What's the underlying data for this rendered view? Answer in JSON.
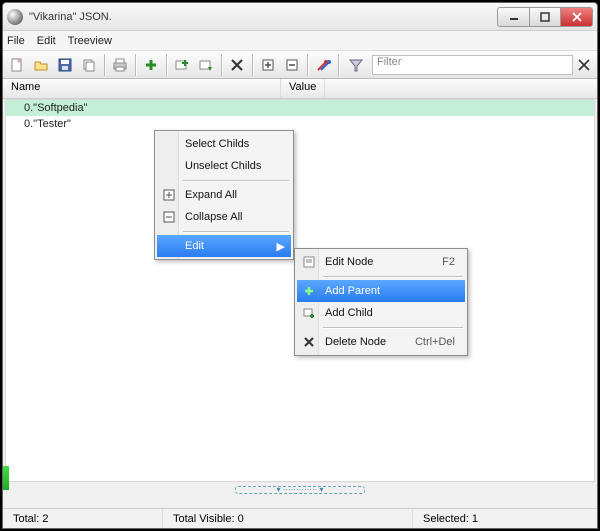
{
  "window": {
    "title": "\"Vikarina\" JSON."
  },
  "menu": {
    "file": "File",
    "edit": "Edit",
    "treeview": "Treeview"
  },
  "toolbar": {
    "filter_label": "Filter",
    "filter_value": ""
  },
  "columns": {
    "name": "Name",
    "value": "Value"
  },
  "tree": {
    "rows": [
      {
        "text": "0.\"Softpedia\"",
        "selected": true
      },
      {
        "text": "0.\"Tester\"",
        "selected": false
      }
    ]
  },
  "context_menu_1": {
    "select_childs": "Select Childs",
    "unselect_childs": "Unselect Childs",
    "expand_all": "Expand All",
    "collapse_all": "Collapse All",
    "edit": "Edit"
  },
  "context_menu_2": {
    "edit_node": "Edit Node",
    "edit_node_shortcut": "F2",
    "add_parent": "Add Parent",
    "add_child": "Add Child",
    "delete_node": "Delete Node",
    "delete_node_shortcut": "Ctrl+Del"
  },
  "status": {
    "total": "Total: 2",
    "total_visible": "Total Visible: 0",
    "selected": "Selected: 1"
  }
}
